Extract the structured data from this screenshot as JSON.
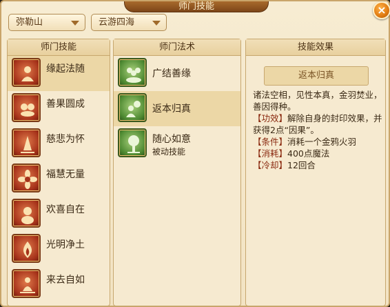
{
  "window": {
    "title": "师门技能",
    "close_glyph": "×"
  },
  "filters": {
    "sect": "弥勒山",
    "region": "云游四海"
  },
  "columns": {
    "skills_header": "师门技能",
    "spells_header": "师门法术",
    "effect_header": "技能效果"
  },
  "skills": [
    {
      "label": "缘起法随",
      "icon": "seated-figure-icon",
      "selected": true
    },
    {
      "label": "善果圆成",
      "icon": "fruit-bowl-icon",
      "selected": false
    },
    {
      "label": "慈悲为怀",
      "icon": "praying-hands-icon",
      "selected": false
    },
    {
      "label": "福慧无量",
      "icon": "lotus-flower-icon",
      "selected": false
    },
    {
      "label": "欢喜自在",
      "icon": "laughing-buddha-icon",
      "selected": false
    },
    {
      "label": "光明净土",
      "icon": "flame-icon",
      "selected": false
    },
    {
      "label": "来去自如",
      "icon": "meditation-figure-icon",
      "selected": false
    }
  ],
  "spells": [
    {
      "label": "广结善缘",
      "sub": "",
      "icon": "group-figures-icon",
      "selected": false
    },
    {
      "label": "返本归真",
      "sub": "",
      "icon": "sun-figure-icon",
      "selected": true
    },
    {
      "label": "随心如意",
      "sub": "被动技能",
      "icon": "tree-figure-icon",
      "selected": false
    }
  ],
  "effect": {
    "name": "返本归真",
    "description": "诸法空相，见性本真，金羽焚业，善因得种。",
    "function_tag": "【功效】",
    "function_text": "解除自身的封印效果，并获得2点“因果”。",
    "condition_tag": "【条件】",
    "condition_text": "消耗一个金鸦火羽",
    "cost_tag": "【消耗】",
    "cost_text": "400点魔法",
    "cooldown_tag": "【冷却】",
    "cooldown_text": "12回合"
  }
}
